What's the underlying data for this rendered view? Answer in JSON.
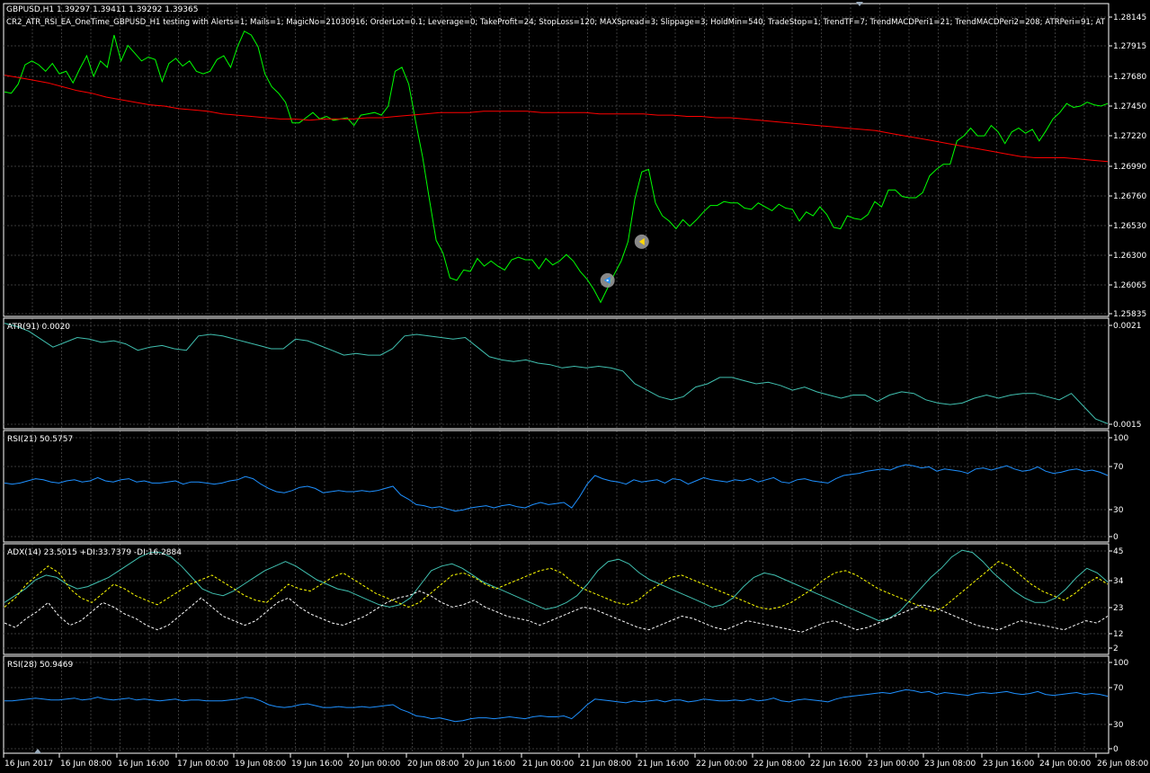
{
  "colors": {
    "background": "#000000",
    "border": "#ffffff",
    "grid": "#3a3a3a",
    "price": "#00ff00",
    "ma": "#ff0000",
    "atr": "#40c0b0",
    "rsi": "#1e90ff",
    "adx_main": "#40c0b0",
    "adx_plus": "#ffff00",
    "adx_minus": "#ffffff",
    "text": "#ffffff"
  },
  "time_axis": [
    "16 Jun 2017",
    "16 Jun 08:00",
    "16 Jun 16:00",
    "17 Jun 00:00",
    "19 Jun 08:00",
    "19 Jun 16:00",
    "20 Jun 00:00",
    "20 Jun 08:00",
    "20 Jun 16:00",
    "21 Jun 00:00",
    "21 Jun 08:00",
    "21 Jun 16:00",
    "22 Jun 00:00",
    "22 Jun 08:00",
    "22 Jun 16:00",
    "23 Jun 00:00",
    "23 Jun 08:00",
    "23 Jun 16:00",
    "24 Jun 00:00",
    "26 Jun 08:00"
  ],
  "chart_data": [
    {
      "name": "main",
      "type": "line",
      "symbol_header": "GBPUSD,H1  1.39297 1.39411 1.39292 1.39365",
      "ea_header": "CR2_ATR_RSI_EA_OneTime_GBPUSD_H1 testing with Alerts=1; Mails=1; MagicNo=21030916; OrderLot=0.1; Leverage=0; TakeProfit=24; StopLoss=120; MAXSpread=3; Slippage=3; HoldMin=540; TradeStop=1; TrendTF=7; TrendMACDPeri1=21; TrendMACDPeri2=208; ATRPeri=91; AT",
      "ylim": [
        1.25835,
        1.2823
      ],
      "yticks": [
        "1.28145",
        "1.27915",
        "1.27680",
        "1.27450",
        "1.27220",
        "1.26990",
        "1.26760",
        "1.26530",
        "1.26300",
        "1.26065",
        "1.25835"
      ],
      "series": [
        {
          "values": [
            1.2756,
            1.2755,
            1.2762,
            1.2777,
            1.278,
            1.2777,
            1.2772,
            1.2778,
            1.277,
            1.2772,
            1.2763,
            1.2774,
            1.2784,
            1.2768,
            1.278,
            1.2775,
            1.28,
            1.278,
            1.2792,
            1.2786,
            1.278,
            1.2783,
            1.2781,
            1.2764,
            1.2778,
            1.2782,
            1.2776,
            1.278,
            1.2772,
            1.277,
            1.2772,
            1.2781,
            1.2784,
            1.2775,
            1.2791,
            1.2803,
            1.28,
            1.2791,
            1.277,
            1.276,
            1.2755,
            1.2748,
            1.2732,
            1.2732,
            1.2736,
            1.274,
            1.2735,
            1.2737,
            1.2734,
            1.2735,
            1.2736,
            1.273,
            1.2738,
            1.2739,
            1.274,
            1.2738,
            1.2745,
            1.2772,
            1.2775,
            1.2762,
            1.2733,
            1.2706,
            1.2673,
            1.2641,
            1.2631,
            1.2612,
            1.261,
            1.2618,
            1.2617,
            1.2627,
            1.2621,
            1.2625,
            1.2621,
            1.2618,
            1.2626,
            1.2628,
            1.2626,
            1.2626,
            1.2619,
            1.2627,
            1.2622,
            1.2625,
            1.263,
            1.2625,
            1.2617,
            1.2611,
            1.2603,
            1.2593,
            1.2604,
            1.2615,
            1.2625,
            1.264,
            1.2673,
            1.2694,
            1.2696,
            1.267,
            1.266,
            1.2656,
            1.265,
            1.2657,
            1.2652,
            1.2657,
            1.2663,
            1.2668,
            1.2668,
            1.2671,
            1.267,
            1.267,
            1.2666,
            1.2665,
            1.267,
            1.2667,
            1.2664,
            1.2669,
            1.2666,
            1.2665,
            1.2656,
            1.2663,
            1.266,
            1.2667,
            1.2661,
            1.2651,
            1.265,
            1.266,
            1.2658,
            1.2657,
            1.2661,
            1.2671,
            1.2667,
            1.268,
            1.268,
            1.2675,
            1.2674,
            1.2674,
            1.2678,
            1.2691,
            1.2696,
            1.27,
            1.27,
            1.2718,
            1.2722,
            1.2728,
            1.2722,
            1.2722,
            1.273,
            1.2725,
            1.2716,
            1.2725,
            1.2728,
            1.2724,
            1.2727,
            1.2718,
            1.2726,
            1.2735,
            1.274,
            1.2747,
            1.2744,
            1.2745,
            1.2748,
            1.2746,
            1.2745,
            1.2747
          ]
        },
        {
          "values": [
            1.2769,
            1.2767,
            1.2765,
            1.2763,
            1.276,
            1.2757,
            1.2755,
            1.2752,
            1.275,
            1.2748,
            1.2746,
            1.2745,
            1.2743,
            1.2742,
            1.2741,
            1.2739,
            1.2738,
            1.2737,
            1.2736,
            1.2735,
            1.2735,
            1.2734,
            1.2735,
            1.2735,
            1.2735,
            1.2736,
            1.2736,
            1.2737,
            1.2738,
            1.2739,
            1.274,
            1.274,
            1.274,
            1.2741,
            1.2741,
            1.2741,
            1.2741,
            1.274,
            1.274,
            1.274,
            1.274,
            1.2739,
            1.2739,
            1.2739,
            1.2739,
            1.2738,
            1.2738,
            1.2737,
            1.2737,
            1.2736,
            1.2736,
            1.2735,
            1.2734,
            1.2733,
            1.2732,
            1.2731,
            1.273,
            1.2729,
            1.2728,
            1.2727,
            1.2726,
            1.2724,
            1.2722,
            1.272,
            1.2718,
            1.2716,
            1.2714,
            1.2712,
            1.271,
            1.2708,
            1.2706,
            1.2705,
            1.2705,
            1.2705,
            1.2704,
            1.2703,
            1.2702
          ]
        }
      ],
      "markers": [
        {
          "kind": "buy-arrow",
          "x_index": 88,
          "value": 1.261
        },
        {
          "kind": "close-arrow",
          "x_index": 93,
          "value": 1.264
        }
      ]
    },
    {
      "name": "atr",
      "type": "line",
      "label": "ATR(91) 0.0020",
      "ylim": [
        0.00145,
        0.00212
      ],
      "yticks": [
        "0.0021",
        "0.0015"
      ],
      "series": [
        {
          "values": [
            0.0021,
            0.00208,
            0.00205,
            0.002,
            0.00195,
            0.00198,
            0.00201,
            0.002,
            0.00198,
            0.00199,
            0.00197,
            0.00193,
            0.00195,
            0.00196,
            0.00194,
            0.00193,
            0.00202,
            0.00203,
            0.00202,
            0.002,
            0.00198,
            0.00196,
            0.00194,
            0.00194,
            0.002,
            0.00199,
            0.00196,
            0.00193,
            0.0019,
            0.00191,
            0.0019,
            0.0019,
            0.00194,
            0.00202,
            0.00203,
            0.00202,
            0.00201,
            0.002,
            0.00201,
            0.00195,
            0.00189,
            0.00187,
            0.00186,
            0.00187,
            0.00185,
            0.00184,
            0.00182,
            0.00183,
            0.00182,
            0.00183,
            0.00182,
            0.0018,
            0.00172,
            0.00168,
            0.00164,
            0.00162,
            0.00164,
            0.0017,
            0.00172,
            0.00176,
            0.00176,
            0.00174,
            0.00172,
            0.00173,
            0.00171,
            0.00168,
            0.0017,
            0.00167,
            0.00165,
            0.00163,
            0.00165,
            0.00165,
            0.00161,
            0.00165,
            0.00167,
            0.00166,
            0.00162,
            0.0016,
            0.00159,
            0.0016,
            0.00163,
            0.00165,
            0.00163,
            0.00165,
            0.00166,
            0.00166,
            0.00164,
            0.00162,
            0.00166,
            0.00158,
            0.0015,
            0.00147
          ]
        }
      ]
    },
    {
      "name": "rsi21",
      "type": "line",
      "label": "RSI(21) 50.5757",
      "ylim": [
        0,
        100
      ],
      "yticks": [
        "100",
        "70",
        "30",
        "0"
      ],
      "series": [
        {
          "values": [
            53,
            52,
            53,
            55,
            57,
            56,
            54,
            53,
            55,
            56,
            54,
            55,
            58,
            55,
            54,
            56,
            57,
            54,
            55,
            53,
            53,
            54,
            55,
            52,
            54,
            54,
            53,
            52,
            53,
            55,
            56,
            59,
            57,
            52,
            48,
            45,
            44,
            46,
            49,
            50,
            48,
            44,
            45,
            46,
            45,
            45,
            46,
            45,
            46,
            48,
            50,
            42,
            38,
            33,
            32,
            30,
            31,
            29,
            27,
            28,
            30,
            31,
            32,
            30,
            32,
            33,
            31,
            30,
            33,
            35,
            33,
            34,
            35,
            30,
            40,
            52,
            60,
            57,
            55,
            54,
            52,
            56,
            54,
            55,
            56,
            53,
            57,
            56,
            52,
            55,
            58,
            56,
            55,
            54,
            56,
            55,
            57,
            54,
            56,
            58,
            54,
            53,
            56,
            57,
            55,
            54,
            53,
            57,
            60,
            61,
            62,
            64,
            65,
            66,
            65,
            68,
            70,
            69,
            67,
            68,
            64,
            66,
            65,
            64,
            62,
            66,
            67,
            65,
            67,
            69,
            66,
            64,
            65,
            68,
            64,
            62,
            63,
            65,
            66,
            64,
            65,
            63,
            60
          ]
        }
      ]
    },
    {
      "name": "adx",
      "type": "line",
      "label": "ADX(14) 23.5015 +DI:33.7379 -DI:16.2884",
      "ylim": [
        0,
        47
      ],
      "yticks": [
        "45",
        "34",
        "23",
        "12",
        "2"
      ],
      "series": [
        {
          "values": [
            22,
            25,
            28,
            32,
            34,
            33,
            30,
            28,
            29,
            31,
            33,
            36,
            39,
            42,
            44,
            44,
            42,
            38,
            33,
            28,
            26,
            25,
            27,
            30,
            33,
            36,
            38,
            40,
            38,
            35,
            32,
            30,
            28,
            27,
            25,
            23,
            21,
            20,
            21,
            24,
            30,
            36,
            38,
            39,
            37,
            34,
            31,
            29,
            27,
            25,
            23,
            21,
            19,
            20,
            22,
            25,
            30,
            36,
            40,
            41,
            39,
            35,
            32,
            30,
            28,
            26,
            24,
            22,
            20,
            21,
            24,
            29,
            33,
            35,
            34,
            32,
            30,
            28,
            26,
            24,
            22,
            20,
            18,
            16,
            14,
            15,
            18,
            23,
            28,
            33,
            37,
            42,
            45,
            44,
            40,
            35,
            31,
            27,
            24,
            22,
            22,
            24,
            28,
            33,
            37,
            35,
            31
          ]
        },
        {
          "values": [
            20,
            24,
            30,
            34,
            38,
            35,
            28,
            24,
            22,
            26,
            30,
            28,
            25,
            23,
            21,
            24,
            27,
            30,
            32,
            34,
            31,
            28,
            25,
            23,
            22,
            26,
            30,
            28,
            27,
            30,
            33,
            35,
            32,
            29,
            26,
            24,
            22,
            20,
            22,
            26,
            30,
            34,
            35,
            33,
            30,
            28,
            30,
            32,
            34,
            36,
            37,
            35,
            31,
            28,
            26,
            24,
            22,
            21,
            23,
            27,
            30,
            33,
            34,
            32,
            30,
            28,
            26,
            24,
            22,
            20,
            19,
            20,
            22,
            25,
            28,
            32,
            35,
            36,
            34,
            31,
            28,
            26,
            24,
            22,
            20,
            18,
            20,
            24,
            28,
            32,
            36,
            40,
            38,
            34,
            30,
            27,
            25,
            23,
            26,
            30,
            33,
            30
          ]
        },
        {
          "values": [
            13,
            11,
            15,
            18,
            22,
            16,
            12,
            14,
            18,
            22,
            20,
            17,
            15,
            12,
            10,
            12,
            16,
            20,
            24,
            20,
            16,
            14,
            12,
            14,
            18,
            22,
            24,
            20,
            17,
            15,
            13,
            12,
            14,
            16,
            19,
            22,
            24,
            25,
            27,
            25,
            22,
            20,
            21,
            23,
            20,
            18,
            16,
            15,
            14,
            12,
            14,
            16,
            18,
            20,
            19,
            17,
            15,
            13,
            11,
            10,
            12,
            14,
            16,
            15,
            13,
            11,
            10,
            12,
            14,
            13,
            12,
            11,
            10,
            9,
            11,
            13,
            14,
            12,
            10,
            11,
            13,
            15,
            17,
            19,
            21,
            20,
            18,
            16,
            14,
            12,
            11,
            10,
            12,
            14,
            13,
            12,
            11,
            10,
            12,
            14,
            13,
            16
          ]
        }
      ]
    },
    {
      "name": "rsi28",
      "type": "line",
      "label": "RSI(28) 50.9469",
      "ylim": [
        0,
        100
      ],
      "yticks": [
        "100",
        "70",
        "30",
        "0"
      ],
      "series": [
        {
          "values": [
            54,
            54,
            55,
            56,
            57,
            56,
            55,
            55,
            56,
            57,
            55,
            56,
            58,
            56,
            55,
            56,
            57,
            55,
            56,
            55,
            54,
            55,
            56,
            54,
            55,
            55,
            54,
            54,
            54,
            55,
            56,
            58,
            57,
            54,
            50,
            48,
            47,
            48,
            50,
            51,
            49,
            47,
            47,
            48,
            47,
            47,
            48,
            47,
            48,
            49,
            50,
            45,
            42,
            38,
            37,
            35,
            36,
            34,
            32,
            33,
            35,
            36,
            36,
            35,
            36,
            37,
            36,
            35,
            37,
            38,
            37,
            37,
            38,
            35,
            42,
            50,
            56,
            55,
            54,
            53,
            52,
            54,
            53,
            54,
            55,
            53,
            55,
            55,
            53,
            54,
            56,
            55,
            54,
            54,
            55,
            54,
            56,
            54,
            55,
            57,
            54,
            53,
            55,
            56,
            55,
            54,
            53,
            56,
            58,
            59,
            60,
            61,
            62,
            63,
            62,
            64,
            66,
            65,
            63,
            64,
            61,
            63,
            62,
            61,
            60,
            62,
            63,
            62,
            63,
            64,
            62,
            61,
            62,
            64,
            61,
            60,
            61,
            62,
            63,
            61,
            62,
            61,
            59
          ]
        }
      ]
    }
  ]
}
